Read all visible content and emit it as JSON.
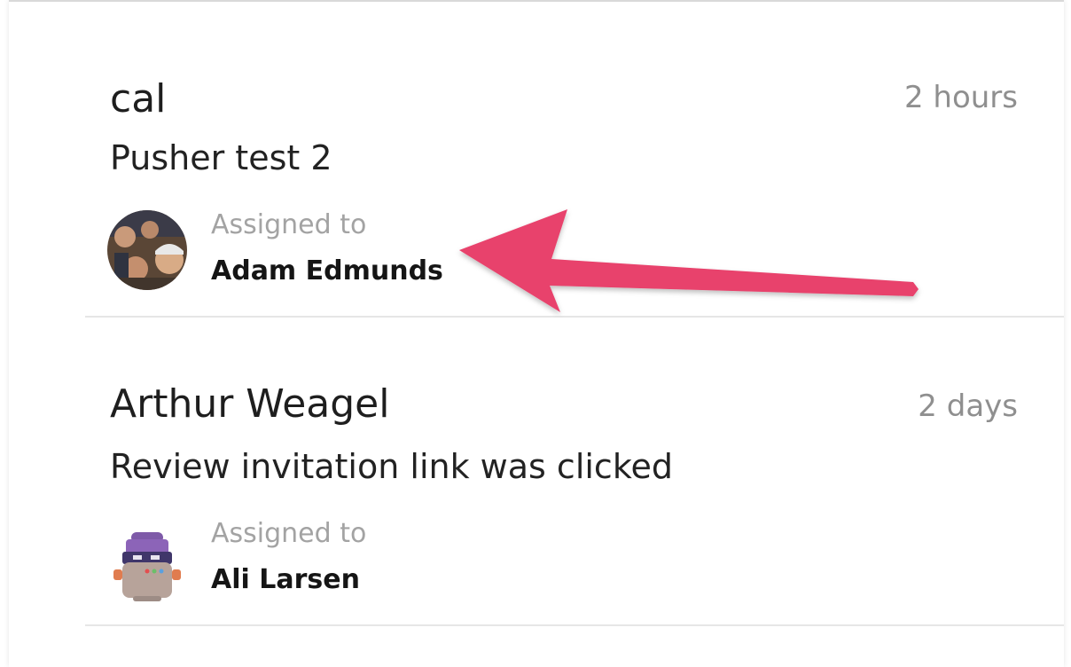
{
  "conversations": [
    {
      "name": "cal",
      "time": "2 hours",
      "subject": "Pusher test 2",
      "assigned_label": "Assigned to",
      "assignee": "Adam Edmunds",
      "avatar_icon": "group-photo-avatar-icon"
    },
    {
      "name": "Arthur Weagel",
      "time": "2 days",
      "subject": "Review invitation link was clicked",
      "assigned_label": "Assigned to",
      "assignee": "Ali Larsen",
      "avatar_icon": "robot-avatar-icon"
    }
  ],
  "annotation": {
    "arrow_color": "#e8426c",
    "icon": "pointer-arrow-icon"
  }
}
